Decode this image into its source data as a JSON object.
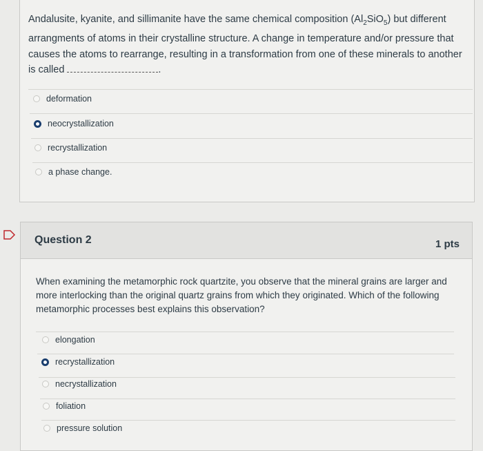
{
  "question1": {
    "text_part1": "Andalusite, kyanite, and sillimanite have the same chemical composition (Al",
    "sub1": "2",
    "text_part2": "SiO",
    "sub2": "5",
    "text_part3": ") but different arrangments of atoms in their crystalline structure. A change in temperature and/or pressure that causes the atoms to rearrange, resulting in a transformation from one of these minerals to another is called",
    "text_end": ".",
    "answers": [
      {
        "label": "deformation",
        "selected": false
      },
      {
        "label": "neocrystallization",
        "selected": true
      },
      {
        "label": "recrystallization",
        "selected": false
      },
      {
        "label": "a phase change.",
        "selected": false
      }
    ]
  },
  "question2": {
    "title": "Question 2",
    "points": "1 pts",
    "text": "When examining the metamorphic rock quartzite, you observe that the mineral grains are larger and more interlocking than the original quartz grains from which they originated. Which of the following metamorphic processes best explains this observation?",
    "answers": [
      {
        "label": "elongation",
        "selected": false
      },
      {
        "label": "recrystallization",
        "selected": true
      },
      {
        "label": "necrystallization",
        "selected": false
      },
      {
        "label": "foliation",
        "selected": false
      },
      {
        "label": "pressure solution",
        "selected": false
      }
    ]
  },
  "colors": {
    "selected_radio": "#1a3e6e",
    "text": "#2d3b45",
    "background": "#ebebe9"
  },
  "icons": {
    "bookmark": "bookmark-icon"
  }
}
